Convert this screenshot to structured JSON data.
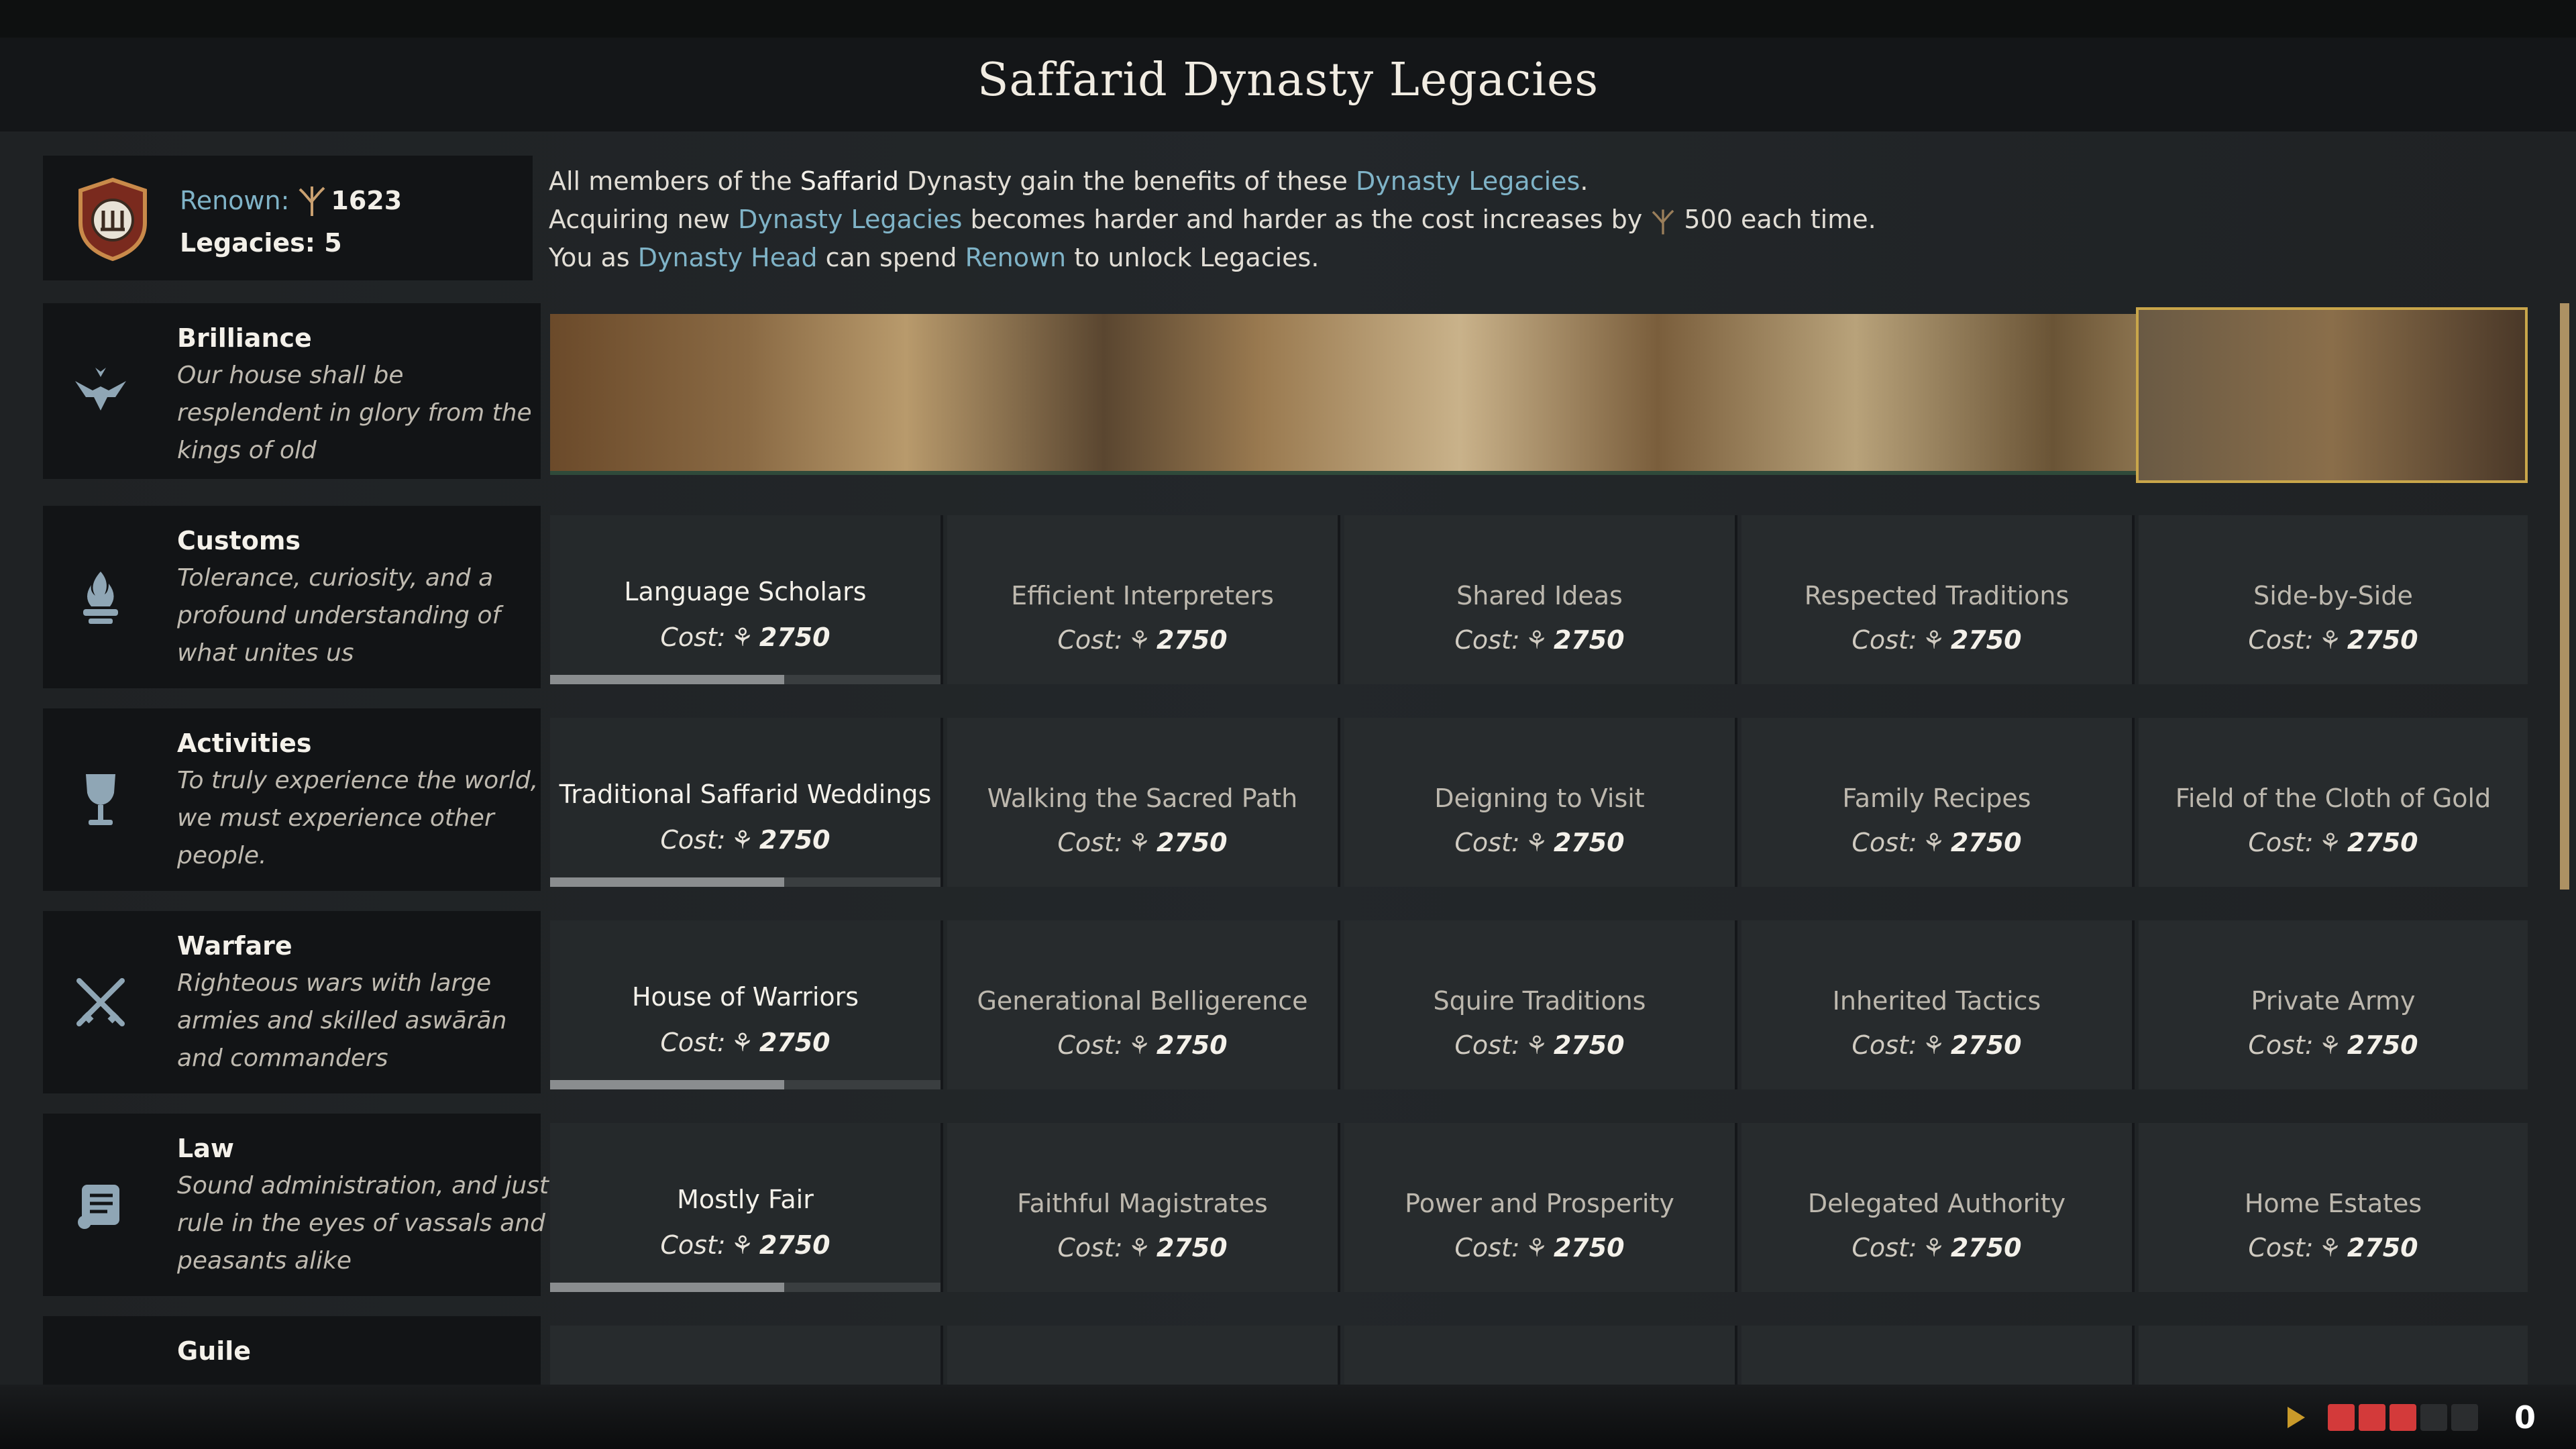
{
  "window": {
    "title": "Saffarid Dynasty Legacies"
  },
  "summary": {
    "renown_label": "Renown:",
    "renown_value": "1623",
    "legacies_label": "Legacies: 5"
  },
  "description": {
    "line1_pre": "All members of the",
    "line1_bold": "Saffarid",
    "line1_mid": "Dynasty gain the benefits of these",
    "line1_link": "Dynasty Legacies",
    "line1_post": ".",
    "line2_pre": "Acquiring new",
    "line2_link": "Dynasty Legacies",
    "line2_mid": "becomes harder and harder as the cost increases by",
    "line2_value": "500",
    "line2_post": "each time.",
    "line3_pre": "You as",
    "line3_link1": "Dynasty Head",
    "line3_mid": "can spend",
    "line3_link2": "Renown",
    "line3_post": "to unlock Legacies."
  },
  "categories": [
    {
      "name": "Brilliance",
      "desc": "Our house shall be resplendent in glory from the kings of old",
      "icon": "eagle-crown-icon"
    },
    {
      "name": "Customs",
      "desc": "Tolerance, curiosity, and a profound understanding of what unites us",
      "icon": "flame-icon"
    },
    {
      "name": "Activities",
      "desc": "To truly experience the world, we must experience other people.",
      "icon": "goblet-icon"
    },
    {
      "name": "Warfare",
      "desc": "Righteous wars with large armies and skilled aswārān and commanders",
      "icon": "crossed-swords-icon"
    },
    {
      "name": "Law",
      "desc": "Sound administration, and just rule in the eyes of vassals and peasants alike",
      "icon": "scroll-icon"
    },
    {
      "name": "Guile",
      "desc": "",
      "icon": "mask-icon"
    }
  ],
  "legacies": {
    "cost_label": "Cost:",
    "rows": [
      [
        {
          "name": "Language Scholars",
          "cost": "2750"
        },
        {
          "name": "Efficient Interpreters",
          "cost": "2750"
        },
        {
          "name": "Shared Ideas",
          "cost": "2750"
        },
        {
          "name": "Respected Traditions",
          "cost": "2750"
        },
        {
          "name": "Side-by-Side",
          "cost": "2750"
        }
      ],
      [
        {
          "name": "Traditional Saffarid Weddings",
          "cost": "2750"
        },
        {
          "name": "Walking the Sacred Path",
          "cost": "2750"
        },
        {
          "name": "Deigning to Visit",
          "cost": "2750"
        },
        {
          "name": "Family Recipes",
          "cost": "2750"
        },
        {
          "name": "Field of the Cloth of Gold",
          "cost": "2750"
        }
      ],
      [
        {
          "name": "House of Warriors",
          "cost": "2750"
        },
        {
          "name": "Generational Belligerence",
          "cost": "2750"
        },
        {
          "name": "Squire Traditions",
          "cost": "2750"
        },
        {
          "name": "Inherited Tactics",
          "cost": "2750"
        },
        {
          "name": "Private Army",
          "cost": "2750"
        }
      ],
      [
        {
          "name": "Mostly Fair",
          "cost": "2750"
        },
        {
          "name": "Faithful Magistrates",
          "cost": "2750"
        },
        {
          "name": "Power and Prosperity",
          "cost": "2750"
        },
        {
          "name": "Delegated Authority",
          "cost": "2750"
        },
        {
          "name": "Home Estates",
          "cost": "2750"
        }
      ]
    ]
  },
  "status_bar": {
    "speed_active": 3,
    "speed_total": 5,
    "counter": "0"
  },
  "colors": {
    "link": "#7fb3c7",
    "accent_gold": "#c9a64a",
    "speed_red": "#d33a3a"
  }
}
